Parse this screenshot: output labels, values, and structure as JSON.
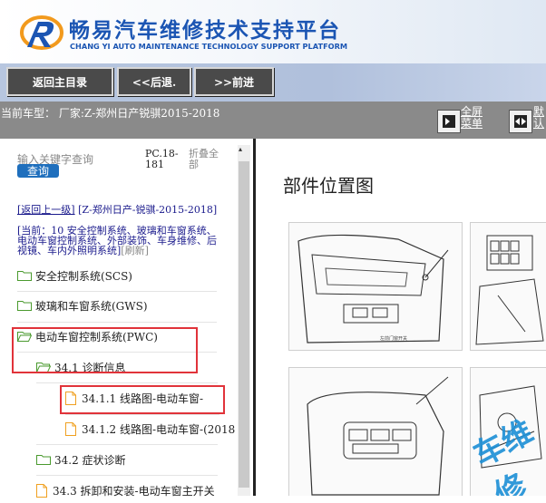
{
  "header": {
    "title": "畅易汽车维修技术支持平台",
    "subtitle": "CHANG YI AUTO MAINTENANCE TECHNOLOGY SUPPORT PLATFORM",
    "brand_color": "#1b55b3"
  },
  "nav": {
    "home": "返回主目录",
    "back": "<<后退.",
    "forward": ">>前进"
  },
  "info": {
    "car": "当前车型：  厂家:Z-郑州日产锐骐2015-2018",
    "fullscreen": "全屏\n菜单",
    "other": "默\n认"
  },
  "sidebar": {
    "search_placeholder": "输入关键字查询",
    "search_button": "查询",
    "pc_label": "PC.18-181",
    "fold_label": "折叠全部",
    "back_link": "[返回上一级]",
    "back_model": "[Z-郑州日产-锐骐-2015-2018]",
    "current_prefix": "[当前：",
    "current_text": "10 安全控制系统、玻璃和车窗系统、电动车窗控制系统、外部装饰、车身维修、后视镜、车内外照明系统]",
    "refresh": "[刷新]",
    "tree": [
      {
        "label": "安全控制系统(SCS)",
        "type": "folder"
      },
      {
        "label": "玻璃和车窗系统(GWS)",
        "type": "folder"
      },
      {
        "label": "电动车窗控制系统(PWC)",
        "type": "folder-open"
      },
      {
        "label": "34.1 诊断信息",
        "type": "folder-open"
      },
      {
        "label": "34.1.1 线路图-电动车窗-",
        "type": "doc"
      },
      {
        "label": "34.1.2 线路图-电动车窗-(2018",
        "type": "doc"
      },
      {
        "label": "34.2 症状诊断",
        "type": "folder"
      },
      {
        "label": "34.3 拆卸和安装-电动车窗主开关",
        "type": "doc"
      }
    ],
    "highlight_color": "#e1333a"
  },
  "document": {
    "title": "部件位置图",
    "figure_caption": "左前门窗开关",
    "watermark": "车维修",
    "relay_labels": [
      "1",
      "2",
      "3",
      "4",
      "5",
      "6"
    ]
  }
}
